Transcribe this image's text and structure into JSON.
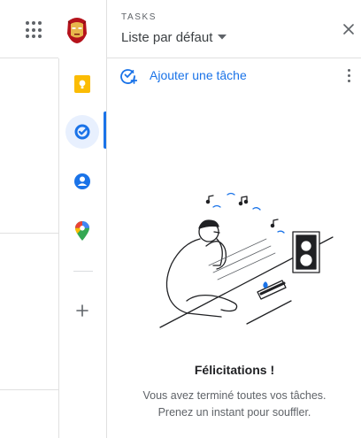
{
  "header": {
    "apps_icon": "apps-grid-icon",
    "avatar_icon": "iron-man-avatar"
  },
  "rail": {
    "items": [
      {
        "name": "keep",
        "icon": "keep-icon",
        "color": "#fbbc04"
      },
      {
        "name": "tasks",
        "icon": "tasks-icon",
        "color": "#1a73e8",
        "active": true
      },
      {
        "name": "contacts",
        "icon": "contacts-icon",
        "color": "#1a73e8"
      },
      {
        "name": "maps",
        "icon": "maps-pin-icon",
        "color": "#34a853"
      }
    ],
    "add_icon": "plus-icon"
  },
  "panel": {
    "kicker": "TASKS",
    "list_name": "Liste par défaut",
    "add_task_label": "Ajouter une tâche",
    "empty_title": "Félicitations !",
    "empty_line1": "Vous avez terminé toutes vos tâches.",
    "empty_line2": "Prenez un instant pour souffler."
  },
  "colors": {
    "accent": "#1a73e8",
    "text_secondary": "#5f6368",
    "divider": "#e0e0e0"
  }
}
